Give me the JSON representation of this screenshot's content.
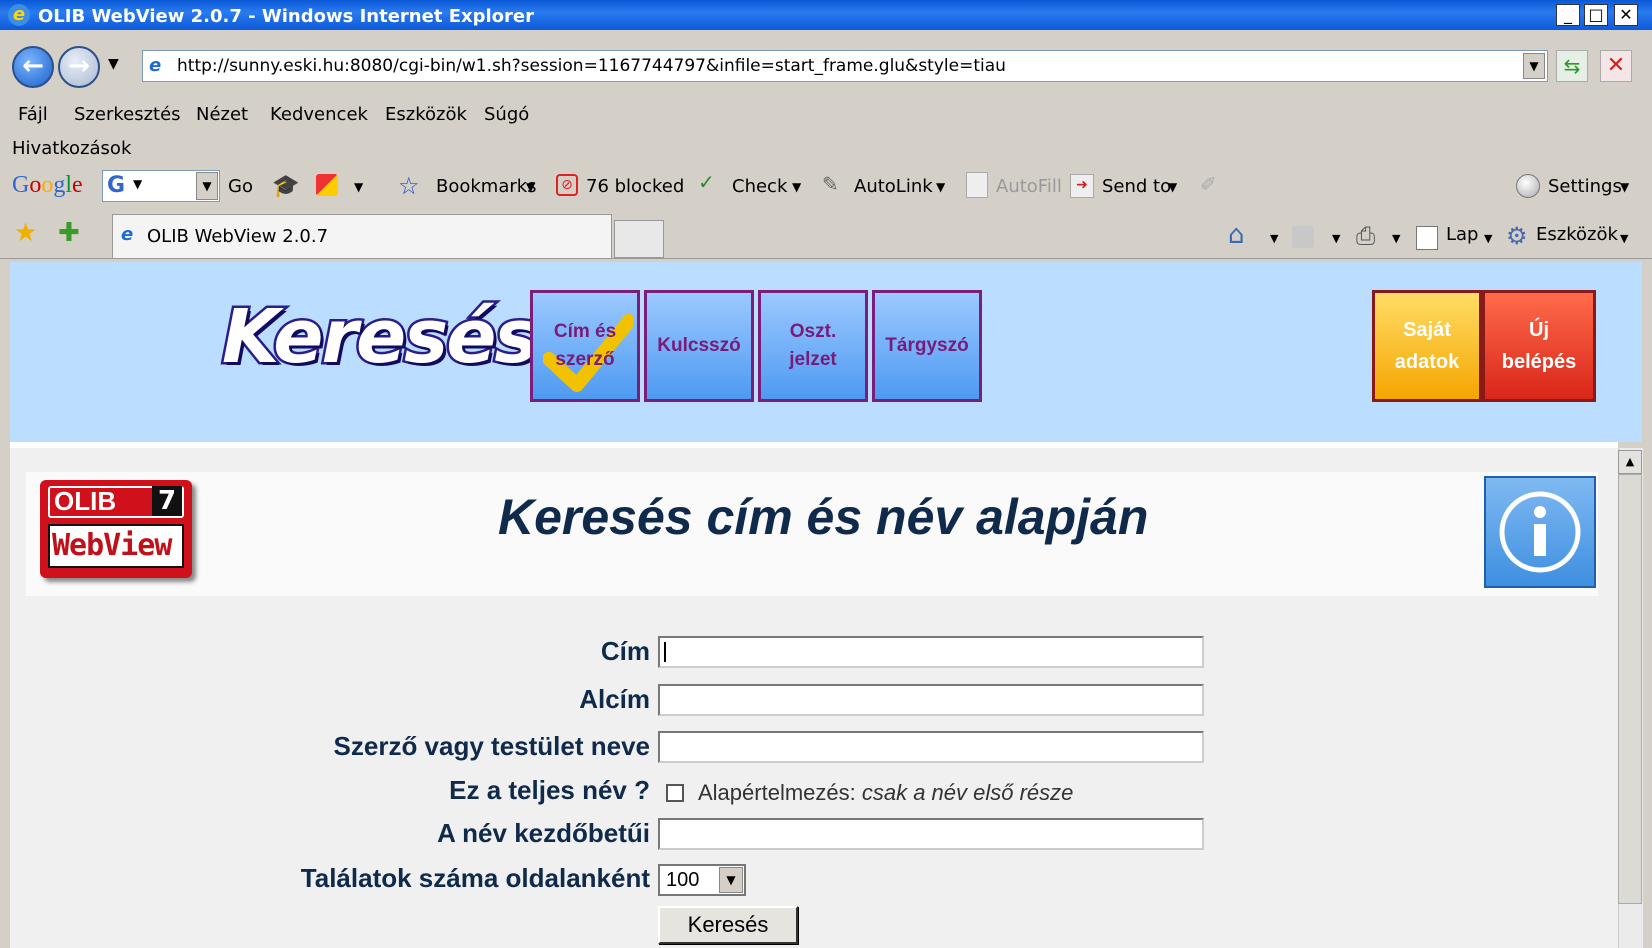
{
  "window": {
    "title": "OLIB WebView 2.0.7 - Windows Internet Explorer",
    "controls": {
      "minimize": "_",
      "maximize": "□",
      "close": "✕"
    }
  },
  "address": {
    "url": "http://sunny.eski.hu:8080/cgi-bin/w1.sh?session=1167744797&infile=start_frame.glu&style=tiau"
  },
  "menu": {
    "items": [
      "Fájl",
      "Szerkesztés",
      "Nézet",
      "Kedvencek",
      "Eszközök",
      "Súgó"
    ],
    "links_label": "Hivatkozások"
  },
  "google_toolbar": {
    "logo": "Google",
    "go": "Go",
    "bookmarks": "Bookmarks",
    "blocked": "76 blocked",
    "check": "Check",
    "autolink": "AutoLink",
    "autofill": "AutoFill",
    "send_to": "Send to",
    "settings": "Settings"
  },
  "tabs": {
    "active_tab": "OLIB WebView 2.0.7",
    "lap": "Lap",
    "eszkozok": "Eszközök"
  },
  "top_nav": {
    "logo_text": "Keresés:",
    "buttons": [
      "Cím és szerző",
      "Kulcsszó",
      "Oszt. jelzet",
      "Tárgyszó"
    ],
    "right_buttons": [
      "Saját adatok",
      "Új belépés"
    ]
  },
  "page": {
    "olib_logo_top": "OLIB",
    "olib_logo_num": "7",
    "olib_logo_bottom": "WebView",
    "title": "Keresés cím és név alapján"
  },
  "form": {
    "cim_label": "Cím",
    "alcim_label": "Alcím",
    "szerzo_label": "Szerző vagy testület neve",
    "teljes_label": "Ez a teljes név ?",
    "default_note_prefix": "Alapértelmezés: ",
    "default_note_italic": "csak a név első része",
    "kezdobetu_label": "A név kezdőbetűi",
    "talalatok_label": "Találatok száma oldalanként",
    "talalatok_value": "100",
    "submit": "Keresés"
  }
}
